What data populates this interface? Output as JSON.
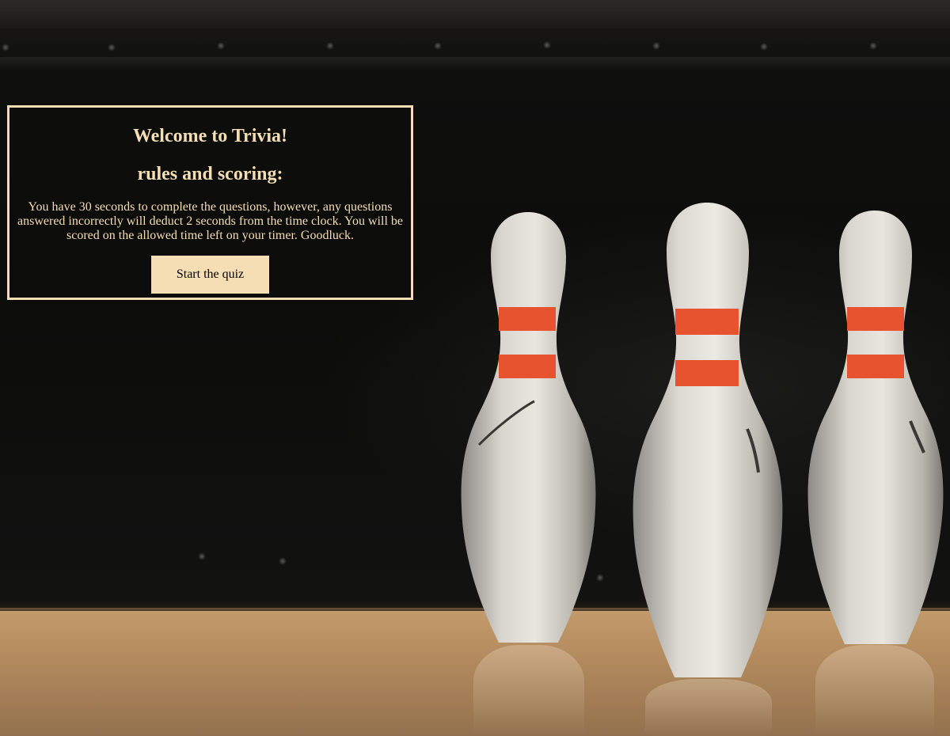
{
  "intro": {
    "title": "Welcome to Trivia!",
    "subtitle": "rules and scoring:",
    "rules_text": "You have 30 seconds to complete the questions, however, any questions answered incorrectly will deduct 2 seconds from the time clock. You will be scored on the allowed time left on your timer. Goodluck.",
    "start_button_label": "Start the quiz"
  },
  "colors": {
    "accent": "#f5deb3",
    "pin_stripe": "#ec4f2b",
    "background": "#0d0d0c",
    "floor": "#c49b6c"
  }
}
